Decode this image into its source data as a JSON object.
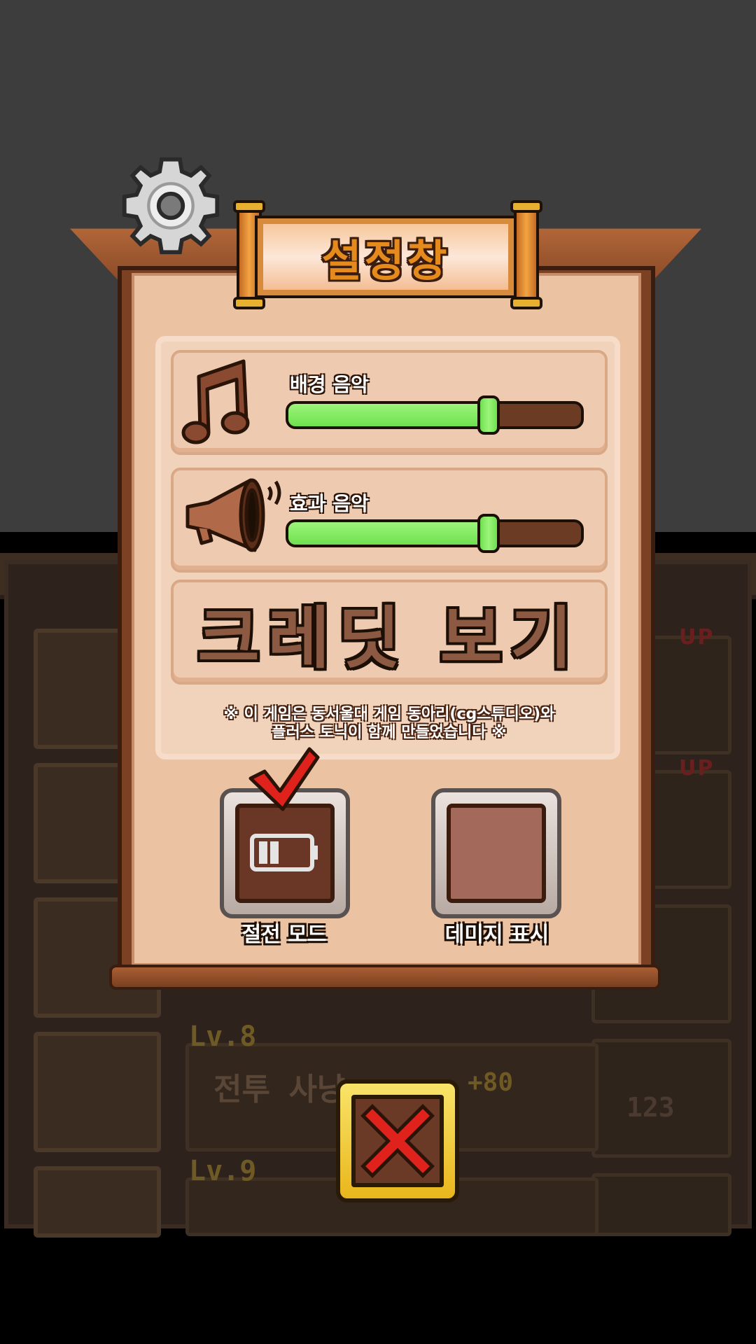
{
  "title": "설정창",
  "settings": {
    "bgm": {
      "label": "배경 음악",
      "level": 0.68,
      "icon": "music-note-icon"
    },
    "sfx": {
      "label": "효과 음악",
      "level": 0.68,
      "icon": "megaphone-icon"
    }
  },
  "credits": {
    "label": "크레딧 보기"
  },
  "note": {
    "line1": "※ 이 게임은 동서울대 게임 동아리(cg스튜디오)와",
    "line2": "플러스 토닉이 함께 만들었습니다 ※"
  },
  "toggles": {
    "power_save": {
      "label": "절전 모드",
      "checked": true,
      "icon": "battery-icon"
    },
    "damage_display": {
      "label": "데미지 표시",
      "checked": false
    }
  },
  "background": {
    "level_a": "Lv.8",
    "level_b": "Lv.9",
    "quest_name": "전투 사냥",
    "reward_bonus": "+80",
    "reward_count": "123",
    "tag": "UP"
  },
  "colors": {
    "accent_green": "#7be85a",
    "wood": "#7c4123",
    "panel": "#ebc3a3",
    "close_red": "#e0221c",
    "check_red": "#e0221c"
  }
}
